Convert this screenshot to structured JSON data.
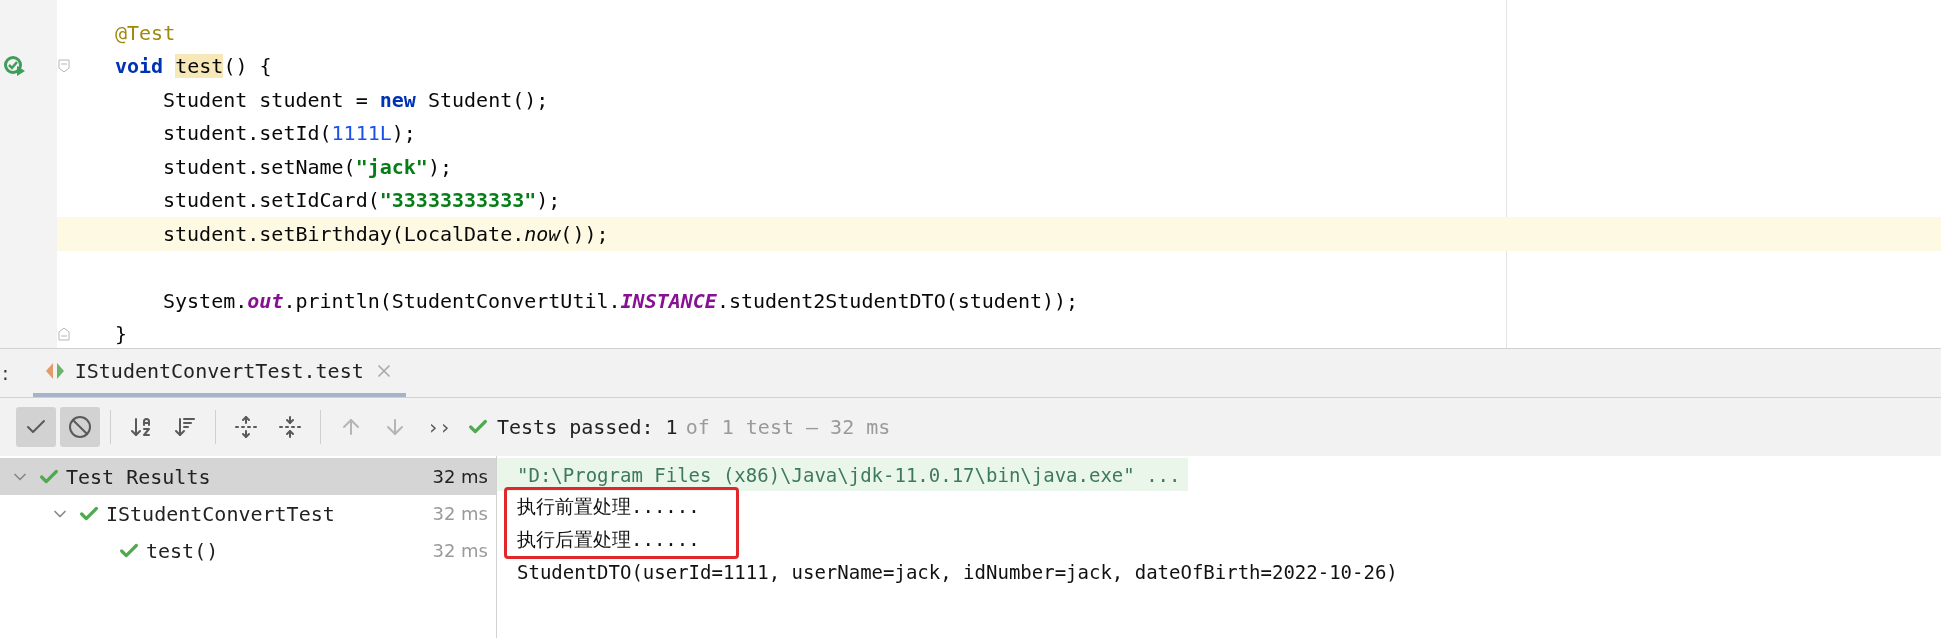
{
  "editor": {
    "lines": [
      {
        "segments": [
          {
            "text": "@Test",
            "kind": "annotation"
          }
        ],
        "indented": false,
        "current": false,
        "fold_start": false,
        "fold_end": false,
        "run_marker": false
      },
      {
        "segments": [
          {
            "text": "void",
            "kind": "keyword"
          },
          {
            "text": "test",
            "kind": "usage"
          },
          {
            "text": "() {",
            "kind": "plain"
          }
        ],
        "indented": false,
        "current": false,
        "fold_start": true,
        "fold_end": false,
        "run_marker": true
      },
      {
        "segments": [
          {
            "text": "Student student =",
            "kind": "plain"
          },
          {
            "text": "new",
            "kind": "keyword"
          },
          {
            "text": "Student();",
            "kind": "plain"
          }
        ],
        "indented": true,
        "current": false,
        "fold_start": false,
        "fold_end": false,
        "run_marker": false
      },
      {
        "segments": [
          {
            "text": "student.setId(",
            "kind": "plain"
          },
          {
            "text": "1111L",
            "kind": "number"
          },
          {
            "text": ");",
            "kind": "plain"
          }
        ],
        "indented": true,
        "current": false,
        "fold_start": false,
        "fold_end": false,
        "run_marker": false
      },
      {
        "segments": [
          {
            "text": "student.setName(",
            "kind": "plain"
          },
          {
            "text": "\"jack\"",
            "kind": "string"
          },
          {
            "text": ");",
            "kind": "plain"
          }
        ],
        "indented": true,
        "current": false,
        "fold_start": false,
        "fold_end": false,
        "run_marker": false
      },
      {
        "segments": [
          {
            "text": "student.setIdCard(",
            "kind": "plain"
          },
          {
            "text": "\"33333333333\"",
            "kind": "string"
          },
          {
            "text": ");",
            "kind": "plain"
          }
        ],
        "indented": true,
        "current": false,
        "fold_start": false,
        "fold_end": false,
        "run_marker": false
      },
      {
        "segments": [
          {
            "text": "student.setBirthday(LocalDate.",
            "kind": "plain"
          },
          {
            "text": "now",
            "kind": "static"
          },
          {
            "text": "());",
            "kind": "plain"
          }
        ],
        "indented": true,
        "current": true,
        "fold_start": false,
        "fold_end": false,
        "run_marker": false
      },
      {
        "current": false,
        "fold_start": false,
        "fold_end": false,
        "run_marker": false
      },
      {
        "segments": [
          {
            "text": "System.",
            "kind": "plain"
          },
          {
            "text": "out",
            "kind": "field"
          },
          {
            "text": ".println(StudentConvertUtil.",
            "kind": "plain"
          },
          {
            "text": "INSTANCE",
            "kind": "field"
          },
          {
            "text": ".student2StudentDTO(student));",
            "kind": "plain"
          }
        ],
        "indented": true,
        "current": false,
        "fold_start": false,
        "fold_end": false,
        "run_marker": false
      },
      {
        "segments": [
          {
            "text": "}",
            "kind": "plain"
          }
        ],
        "indented": false,
        "current": false,
        "fold_start": false,
        "fold_end": true,
        "run_marker": false
      }
    ]
  },
  "run_window": {
    "label": ":",
    "tabs": [
      {
        "label": "IStudentConvertTest.test",
        "selected": true
      }
    ],
    "toolbar": [
      {
        "buttons": [
          {
            "kind": "show_passed",
            "selected": true,
            "disabled": false
          },
          {
            "kind": "show_ignored",
            "selected": true,
            "disabled": false
          }
        ]
      },
      {
        "buttons": [
          {
            "kind": "sort_alpha",
            "selected": false,
            "disabled": false
          },
          {
            "kind": "sort_duration",
            "selected": false,
            "disabled": false
          }
        ]
      },
      {
        "buttons": [
          {
            "kind": "expand_all",
            "selected": false,
            "disabled": false
          },
          {
            "kind": "collapse_all",
            "selected": false,
            "disabled": false
          }
        ]
      },
      {
        "buttons": [
          {
            "kind": "previous",
            "selected": false,
            "disabled": true
          },
          {
            "kind": "next",
            "selected": false,
            "disabled": true
          },
          {
            "kind": "more",
            "label": "››",
            "selected": false,
            "disabled": false
          }
        ]
      }
    ],
    "status": {
      "passed": true,
      "summary": "Tests passed: 1",
      "detail": "of 1 test – 32 ms"
    },
    "tree": [
      {
        "label": "Test Results",
        "time": "32 ms",
        "passed": true,
        "selected": true,
        "expanded": true,
        "children": [
          {
            "label": "IStudentConvertTest",
            "time": "32 ms",
            "passed": true,
            "selected": false,
            "expanded": true,
            "children": [
              {
                "label": "test()",
                "time": "32 ms",
                "passed": true,
                "selected": false
              }
            ]
          }
        ]
      }
    ],
    "console": [
      {
        "text": "\"D:\\Program Files (x86)\\Java\\jdk-11.0.17\\bin\\java.exe\" ...",
        "kind": "command",
        "boxed": false
      },
      {
        "text": "执行前置处理......",
        "kind": "output",
        "boxed": true
      },
      {
        "text": "执行后置处理......",
        "kind": "output",
        "boxed": true
      },
      {
        "text": "StudentDTO(userId=1111, userName=jack, idNumber=jack, dateOfBirth=2022-10-26)",
        "kind": "output",
        "boxed": false
      }
    ]
  }
}
